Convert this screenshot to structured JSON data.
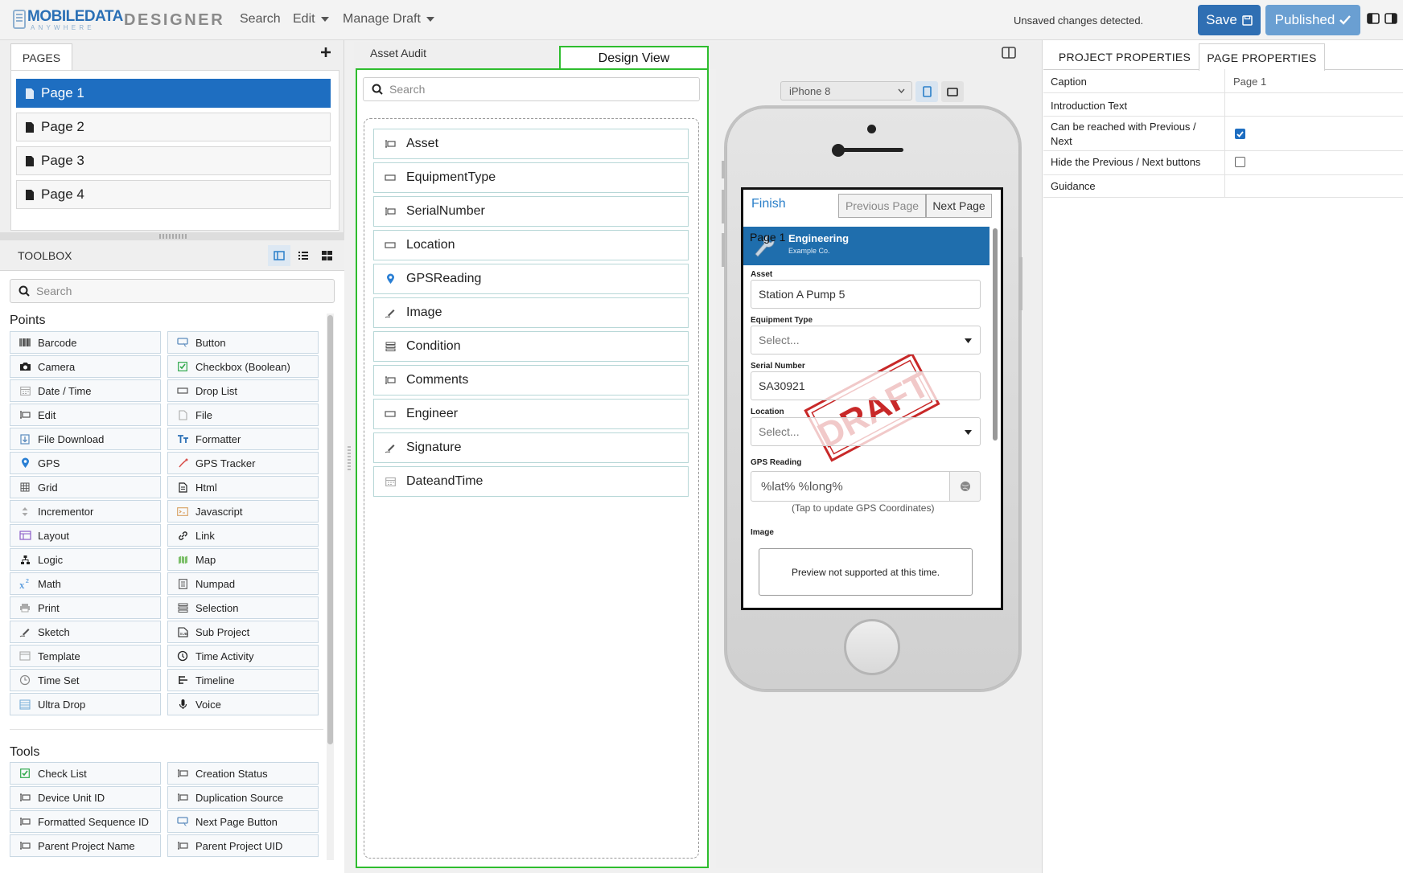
{
  "app": {
    "brand_top": "MOBILEDATA",
    "brand_bottom": "ANYWHERE",
    "designer": "DESIGNER",
    "menu": {
      "search": "Search",
      "edit": "Edit",
      "manage_draft": "Manage Draft"
    },
    "status": "Unsaved changes detected.",
    "save_label": "Save",
    "published_label": "Published"
  },
  "pages_panel": {
    "tab": "PAGES",
    "items": [
      {
        "label": "Page 1",
        "active": true
      },
      {
        "label": "Page 2",
        "active": false
      },
      {
        "label": "Page 3",
        "active": false
      },
      {
        "label": "Page 4",
        "active": false
      }
    ]
  },
  "toolbox": {
    "title": "TOOLBOX",
    "search_placeholder": "Search",
    "points_title": "Points",
    "points": [
      [
        "Barcode",
        "Button"
      ],
      [
        "Camera",
        "Checkbox (Boolean)"
      ],
      [
        "Date / Time",
        "Drop List"
      ],
      [
        "Edit",
        "File"
      ],
      [
        "File Download",
        "Formatter"
      ],
      [
        "GPS",
        "GPS Tracker"
      ],
      [
        "Grid",
        "Html"
      ],
      [
        "Incrementor",
        "Javascript"
      ],
      [
        "Layout",
        "Link"
      ],
      [
        "Logic",
        "Map"
      ],
      [
        "Math",
        "Numpad"
      ],
      [
        "Print",
        "Selection"
      ],
      [
        "Sketch",
        "Sub Project"
      ],
      [
        "Template",
        "Time Activity"
      ],
      [
        "Time Set",
        "Timeline"
      ],
      [
        "Ultra Drop",
        "Voice"
      ]
    ],
    "tools_title": "Tools",
    "tools": [
      [
        "Check List",
        "Creation Status"
      ],
      [
        "Device Unit ID",
        "Duplication Source"
      ],
      [
        "Formatted Sequence ID",
        "Next Page Button"
      ],
      [
        "Parent Project Name",
        "Parent Project UID"
      ]
    ]
  },
  "design": {
    "project_tab": "Asset Audit",
    "view_tab": "Design View",
    "search_placeholder": "Search",
    "fields": [
      "Asset",
      "EquipmentType",
      "SerialNumber",
      "Location",
      "GPSReading",
      "Image",
      "Condition",
      "Comments",
      "Engineer",
      "Signature",
      "DateandTime"
    ]
  },
  "preview": {
    "device": "iPhone 8",
    "finish": "Finish",
    "prev": "Previous Page",
    "next": "Next Page",
    "page_label": "Page 1",
    "banner_title": "Engineering",
    "banner_sub": "Example Co.",
    "asset_label": "Asset",
    "asset_value": "Station A Pump 5",
    "equip_label": "Equipment Type",
    "equip_value": "Select...",
    "serial_label": "Serial Number",
    "serial_value": "SA30921",
    "location_label": "Location",
    "location_value": "Select...",
    "gps_label": "GPS Reading",
    "gps_value": "%lat% %long%",
    "gps_hint": "(Tap to update GPS Coordinates)",
    "image_label": "Image",
    "image_msg": "Preview not supported at this time.",
    "watermark": "DRAFT"
  },
  "properties": {
    "tab_project": "PROJECT PROPERTIES",
    "tab_page": "PAGE PROPERTIES",
    "rows": [
      {
        "key": "Caption",
        "value": "Page 1"
      },
      {
        "key": "Introduction Text",
        "value": ""
      },
      {
        "key": "Can be reached with Previous / Next",
        "checked": true
      },
      {
        "key": "Hide the Previous / Next buttons",
        "checked": false
      },
      {
        "key": "Guidance",
        "value": ""
      }
    ]
  },
  "colors": {
    "primary": "#1e6ec1",
    "design_border": "#2ebd2e",
    "published": "#6a9fd2"
  }
}
